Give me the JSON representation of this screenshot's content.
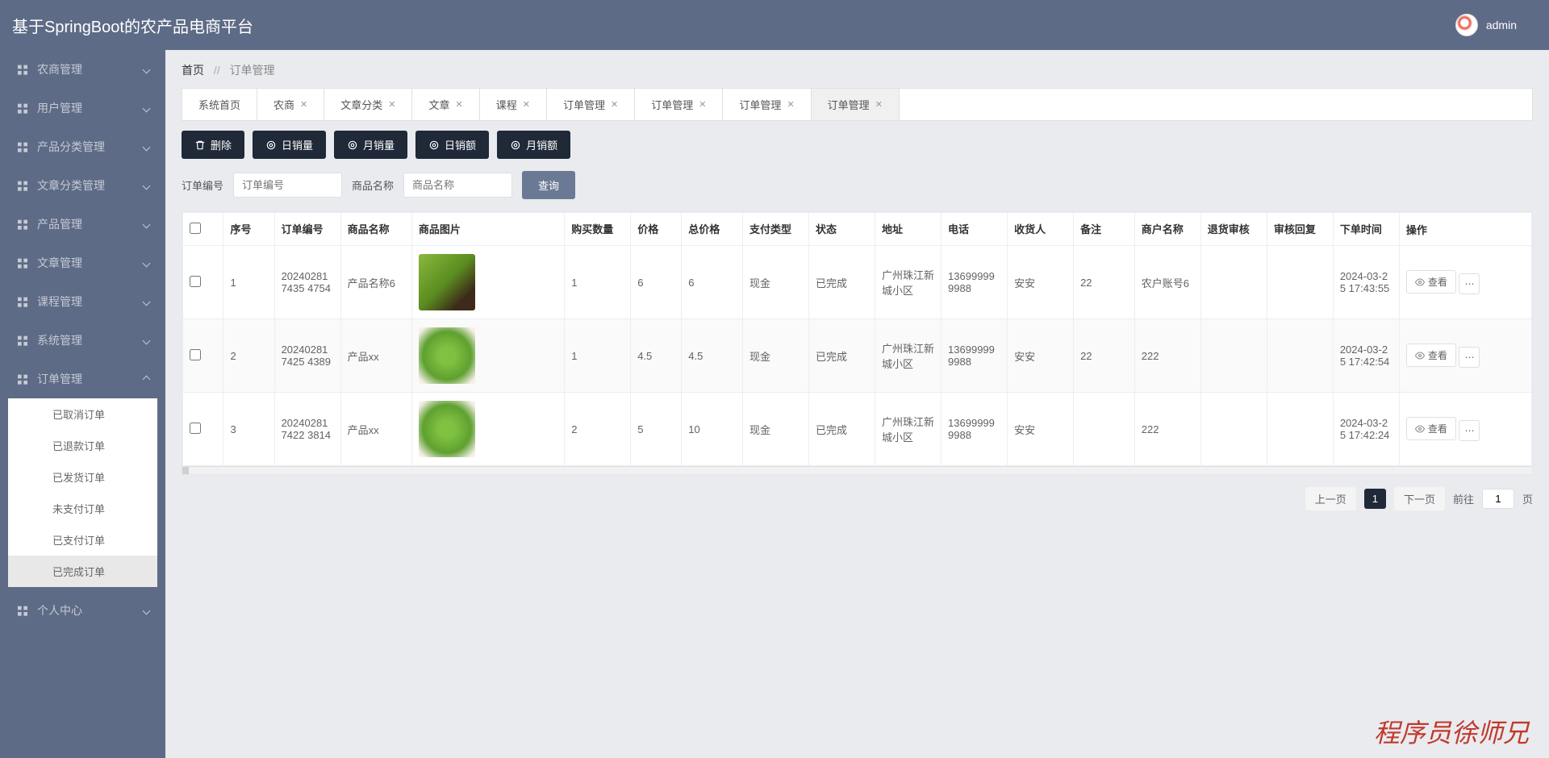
{
  "header": {
    "title": "基于SpringBoot的农产品电商平台",
    "username": "admin"
  },
  "sidebar": [
    {
      "label": "农商管理",
      "open": false
    },
    {
      "label": "用户管理",
      "open": false
    },
    {
      "label": "产品分类管理",
      "open": false
    },
    {
      "label": "文章分类管理",
      "open": false
    },
    {
      "label": "产品管理",
      "open": false
    },
    {
      "label": "文章管理",
      "open": false
    },
    {
      "label": "课程管理",
      "open": false
    },
    {
      "label": "系统管理",
      "open": false
    },
    {
      "label": "订单管理",
      "open": true,
      "children": [
        {
          "label": "已取消订单"
        },
        {
          "label": "已退款订单"
        },
        {
          "label": "已发货订单"
        },
        {
          "label": "未支付订单"
        },
        {
          "label": "已支付订单"
        },
        {
          "label": "已完成订单",
          "active": true
        }
      ]
    },
    {
      "label": "个人中心",
      "open": false
    }
  ],
  "breadcrumb": {
    "home": "首页",
    "current": "订单管理"
  },
  "tabs": [
    {
      "label": "系统首页",
      "closable": false
    },
    {
      "label": "农商",
      "closable": true
    },
    {
      "label": "文章分类",
      "closable": true
    },
    {
      "label": "文章",
      "closable": true
    },
    {
      "label": "课程",
      "closable": true
    },
    {
      "label": "订单管理",
      "closable": true
    },
    {
      "label": "订单管理",
      "closable": true
    },
    {
      "label": "订单管理",
      "closable": true
    },
    {
      "label": "订单管理",
      "closable": true,
      "active": true
    }
  ],
  "toolbar": {
    "delete": "删除",
    "daily_sales": "日销量",
    "monthly_sales": "月销量",
    "daily_revenue": "日销额",
    "monthly_revenue": "月销额"
  },
  "search": {
    "order_label": "订单编号",
    "order_ph": "订单编号",
    "product_label": "商品名称",
    "product_ph": "商品名称",
    "query": "查询"
  },
  "columns": {
    "seq": "序号",
    "order_no": "订单编号",
    "product": "商品名称",
    "image": "商品图片",
    "qty": "购买数量",
    "price": "价格",
    "total": "总价格",
    "pay_type": "支付类型",
    "status": "状态",
    "address": "地址",
    "phone": "电话",
    "receiver": "收货人",
    "note": "备注",
    "merchant": "商户名称",
    "return_audit": "退货审核",
    "audit_reply": "审核回复",
    "order_time": "下单时间",
    "operation": "操作"
  },
  "rows": [
    {
      "seq": "1",
      "order_no": "202402817435 4754",
      "product": "产品名称6",
      "img": "veg",
      "qty": "1",
      "price": "6",
      "total": "6",
      "pay_type": "现金",
      "status": "已完成",
      "address": "广州珠江新城小区",
      "phone": "136999999988",
      "receiver": "安安",
      "note": "22",
      "merchant": "农户账号6",
      "return_audit": "",
      "audit_reply": "",
      "order_time": "2024-03-25 17:43:55"
    },
    {
      "seq": "2",
      "order_no": "202402817425 4389",
      "product": "产品xx",
      "img": "lettuce",
      "qty": "1",
      "price": "4.5",
      "total": "4.5",
      "pay_type": "现金",
      "status": "已完成",
      "address": "广州珠江新城小区",
      "phone": "136999999988",
      "receiver": "安安",
      "note": "22",
      "merchant": "222",
      "return_audit": "",
      "audit_reply": "",
      "order_time": "2024-03-25 17:42:54"
    },
    {
      "seq": "3",
      "order_no": "202402817422 3814",
      "product": "产品xx",
      "img": "lettuce",
      "qty": "2",
      "price": "5",
      "total": "10",
      "pay_type": "现金",
      "status": "已完成",
      "address": "广州珠江新城小区",
      "phone": "136999999988",
      "receiver": "安安",
      "note": "",
      "merchant": "222",
      "return_audit": "",
      "audit_reply": "",
      "order_time": "2024-03-25 17:42:24"
    }
  ],
  "actions": {
    "view": "查看"
  },
  "pagination": {
    "prev": "上一页",
    "current": "1",
    "next": "下一页",
    "goto": "前往",
    "goto_val": "1",
    "page_suffix": "页"
  },
  "watermark": "程序员徐师兄"
}
